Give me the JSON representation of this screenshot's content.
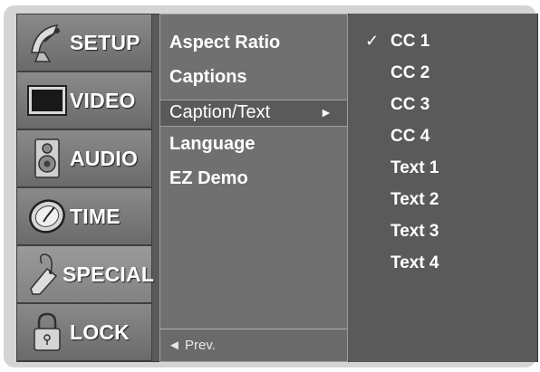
{
  "tabs": [
    {
      "label": "SETUP",
      "icon": "satellite-dish-icon"
    },
    {
      "label": "VIDEO",
      "icon": "tv-screen-icon"
    },
    {
      "label": "AUDIO",
      "icon": "speaker-icon"
    },
    {
      "label": "TIME",
      "icon": "clock-icon"
    },
    {
      "label": "SPECIAL",
      "icon": "tag-icon"
    },
    {
      "label": "LOCK",
      "icon": "padlock-icon"
    }
  ],
  "active_tab": "SPECIAL",
  "menu": {
    "items": [
      "Aspect Ratio",
      "Captions",
      "Caption/Text",
      "Language",
      "EZ Demo"
    ],
    "selected": "Caption/Text",
    "selected_arrow": "►",
    "prev_label": "◄ Prev."
  },
  "submenu": {
    "options": [
      "CC 1",
      "CC 2",
      "CC 3",
      "CC 4",
      "Text 1",
      "Text 2",
      "Text 3",
      "Text 4"
    ],
    "checked": "CC 1",
    "check_mark": "✓"
  }
}
